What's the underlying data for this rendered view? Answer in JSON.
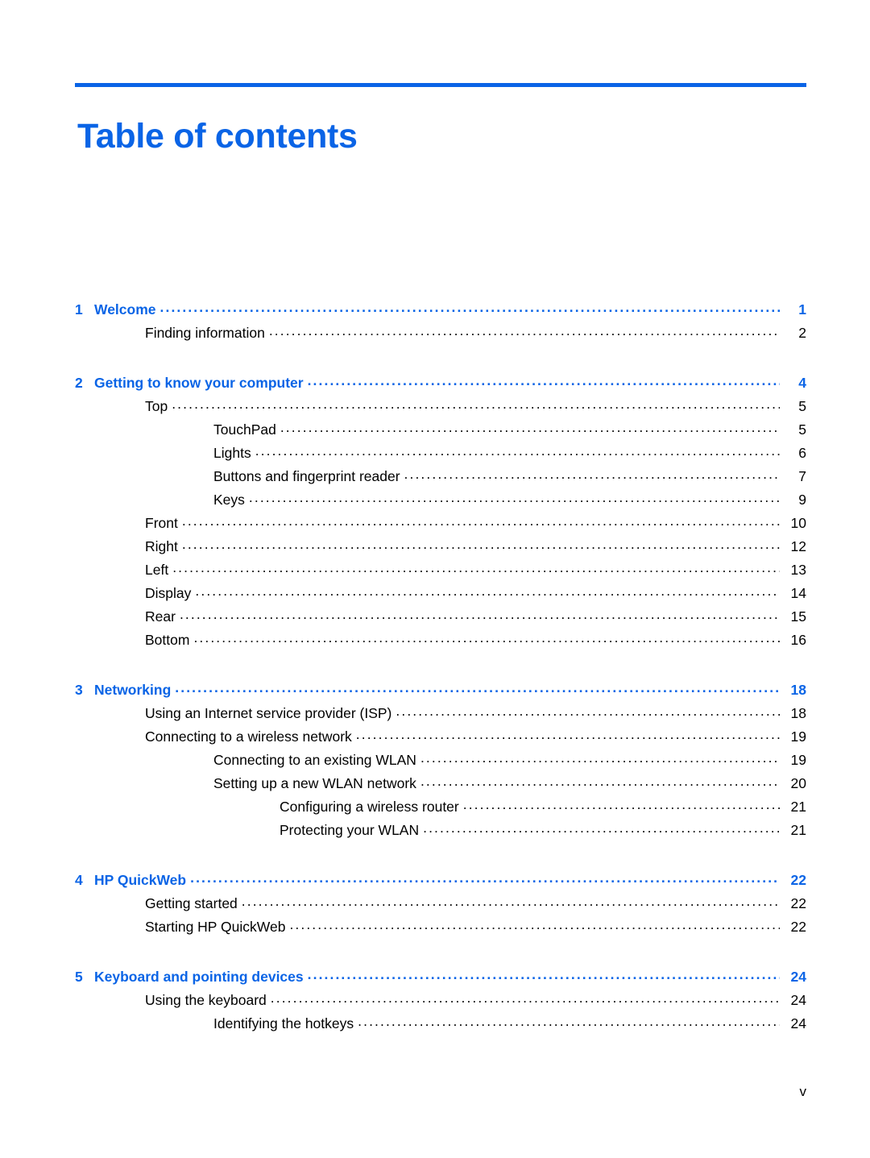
{
  "document": {
    "title": "Table of contents",
    "accent_color": "#0a64e6",
    "footer_page_number": "v"
  },
  "toc": {
    "groups": [
      {
        "entries": [
          {
            "level": 1,
            "number": "1",
            "label": "Welcome",
            "page": "1"
          },
          {
            "level": 2,
            "number": "",
            "label": "Finding information",
            "page": "2"
          }
        ]
      },
      {
        "entries": [
          {
            "level": 1,
            "number": "2",
            "label": "Getting to know your computer",
            "page": "4"
          },
          {
            "level": 2,
            "number": "",
            "label": "Top",
            "page": "5"
          },
          {
            "level": 3,
            "number": "",
            "label": "TouchPad",
            "page": "5"
          },
          {
            "level": 3,
            "number": "",
            "label": "Lights",
            "page": "6"
          },
          {
            "level": 3,
            "number": "",
            "label": "Buttons and fingerprint reader",
            "page": "7"
          },
          {
            "level": 3,
            "number": "",
            "label": "Keys",
            "page": "9"
          },
          {
            "level": 2,
            "number": "",
            "label": "Front",
            "page": "10"
          },
          {
            "level": 2,
            "number": "",
            "label": "Right",
            "page": "12"
          },
          {
            "level": 2,
            "number": "",
            "label": "Left",
            "page": "13"
          },
          {
            "level": 2,
            "number": "",
            "label": "Display",
            "page": "14"
          },
          {
            "level": 2,
            "number": "",
            "label": "Rear",
            "page": "15"
          },
          {
            "level": 2,
            "number": "",
            "label": "Bottom",
            "page": "16"
          }
        ]
      },
      {
        "entries": [
          {
            "level": 1,
            "number": "3",
            "label": "Networking",
            "page": "18"
          },
          {
            "level": 2,
            "number": "",
            "label": "Using an Internet service provider (ISP)",
            "page": "18"
          },
          {
            "level": 2,
            "number": "",
            "label": "Connecting to a wireless network",
            "page": "19"
          },
          {
            "level": 3,
            "number": "",
            "label": "Connecting to an existing WLAN",
            "page": "19"
          },
          {
            "level": 3,
            "number": "",
            "label": "Setting up a new WLAN network",
            "page": "20"
          },
          {
            "level": 4,
            "number": "",
            "label": "Configuring a wireless router",
            "page": "21"
          },
          {
            "level": 4,
            "number": "",
            "label": "Protecting your WLAN",
            "page": "21"
          }
        ]
      },
      {
        "entries": [
          {
            "level": 1,
            "number": "4",
            "label": "HP QuickWeb",
            "page": "22"
          },
          {
            "level": 2,
            "number": "",
            "label": "Getting started",
            "page": "22"
          },
          {
            "level": 2,
            "number": "",
            "label": "Starting HP QuickWeb",
            "page": "22"
          }
        ]
      },
      {
        "entries": [
          {
            "level": 1,
            "number": "5",
            "label": "Keyboard and pointing devices",
            "page": "24"
          },
          {
            "level": 2,
            "number": "",
            "label": "Using the keyboard",
            "page": "24"
          },
          {
            "level": 3,
            "number": "",
            "label": "Identifying the hotkeys",
            "page": "24"
          }
        ]
      }
    ]
  }
}
